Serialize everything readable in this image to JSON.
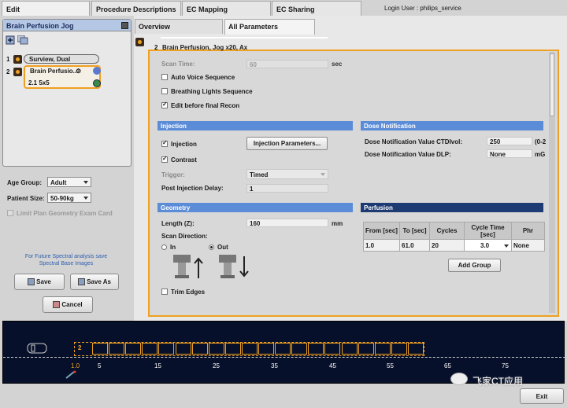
{
  "top_tabs": [
    "Edit",
    "Procedure Descriptions",
    "EC Mapping",
    "EC Sharing"
  ],
  "login": "Login User : philips_service",
  "left": {
    "protocol": "Brain Perfusion Jog",
    "series": [
      {
        "num": "1",
        "label": "Surview, Dual"
      },
      {
        "num": "2",
        "label": "Brain Perfusio..."
      }
    ],
    "recon": "2.1 5x5",
    "age_group_label": "Age Group:",
    "age_group": "Adult",
    "patient_size_label": "Patient Size:",
    "patient_size": "50-90kg",
    "limit_label": "Limit Plan Geometry Exam Card",
    "hint": "For Future Spectral analysis save Spectral Base Images",
    "save": "Save",
    "save_as": "Save As",
    "cancel": "Cancel"
  },
  "sub_tabs": [
    "Overview",
    "All Parameters"
  ],
  "params": {
    "series_num": "2",
    "title": "Brain Perfusion, Jog x20, Ax",
    "scan_time_label": "Scan Time:",
    "scan_time": "60",
    "scan_time_unit": "sec",
    "auto_voice": "Auto Voice Sequence",
    "breathing": "Breathing Lights Sequence",
    "edit_before": "Edit before final Recon",
    "injection_section": "Injection",
    "injection": "Injection",
    "injection_params": "Injection Parameters...",
    "contrast": "Contrast",
    "trigger_label": "Trigger:",
    "trigger": "Timed",
    "post_delay_label": "Post Injection Delay:",
    "post_delay": "1",
    "dose_section": "Dose Notification",
    "ctdi_label": "Dose Notification Value CTDIvol:",
    "ctdi": "250",
    "ctdi_suffix": "(0-2",
    "dlp_label": "Dose Notification Value DLP:",
    "dlp": "None",
    "dlp_suffix": "mG",
    "geometry_section": "Geometry",
    "length_label": "Length (Z):",
    "length": "160",
    "length_unit": "mm",
    "scan_dir_label": "Scan Direction:",
    "dir_in": "In",
    "dir_out": "Out",
    "trim_edges": "Trim Edges",
    "perfusion_section": "Perfusion",
    "table_headers": [
      "From [sec]",
      "To [sec]",
      "Cycles",
      "Cycle Time [sec]",
      "Phr"
    ],
    "table_row": [
      "1.0",
      "61.0",
      "20",
      "3.0",
      "None"
    ],
    "add_group": "Add Group"
  },
  "timeline": {
    "seq_num": "2",
    "ticks": [
      "1.0",
      "5",
      "15",
      "25",
      "35",
      "45",
      "55",
      "65",
      "75"
    ]
  },
  "watermark": "飞家CT应用",
  "exit": "Exit"
}
